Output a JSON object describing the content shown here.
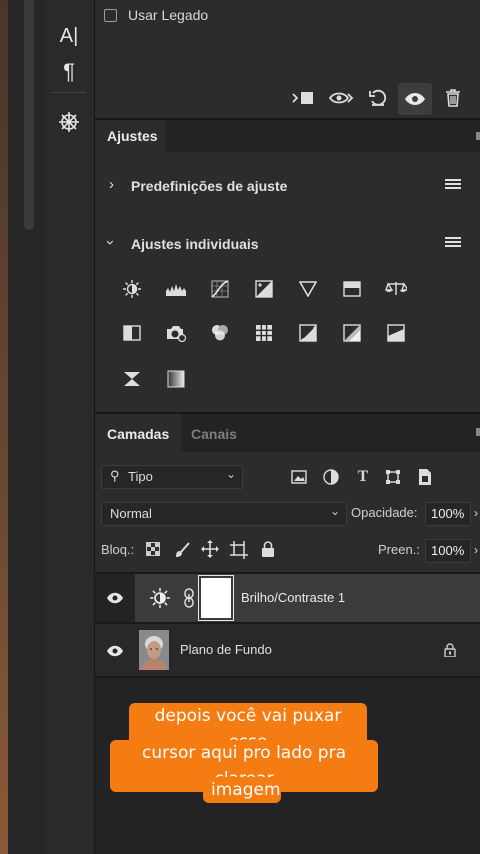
{
  "top_panel": {
    "checkbox_label": "Usar Legado"
  },
  "toolbar": {
    "tools": [
      {
        "name": "text-tool-icon",
        "glyph": "A|"
      },
      {
        "name": "paragraph-icon",
        "glyph": "¶"
      },
      {
        "name": "3d-icon",
        "glyph": "⎈"
      }
    ]
  },
  "adjustments": {
    "tab_label": "Ajustes",
    "presets_label": "Predefinições de ajuste",
    "individual_label": "Ajustes individuais"
  },
  "layers": {
    "tabs": [
      "Camadas",
      "Canais"
    ],
    "filter_kind": "Tipo",
    "blend_mode": "Normal",
    "opacity_label": "Opacidade:",
    "opacity_value": "100%",
    "lock_label": "Bloq.:",
    "fill_label": "Preen.:",
    "fill_value": "100%",
    "items": [
      {
        "name": "Brilho/Contraste 1"
      },
      {
        "name": "Plano de Fundo"
      }
    ]
  },
  "caption": {
    "line1": "depois você vai puxar esse",
    "line2": "cursor aqui pro lado pra clarear",
    "line3": "imagem"
  },
  "colors": {
    "caption_bg": "#f57c12",
    "panel_bg": "#2c2c2c",
    "selected_layer_bg": "#3a3a3a"
  }
}
